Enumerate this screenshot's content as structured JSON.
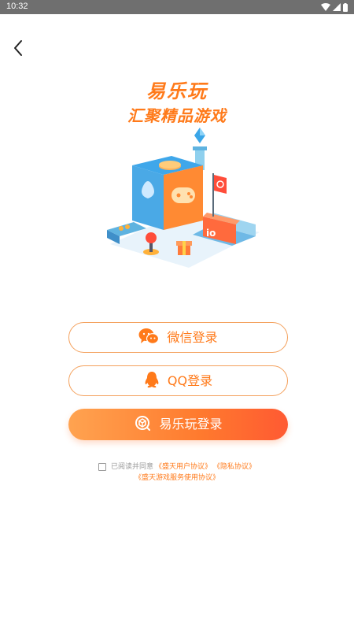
{
  "status_bar": {
    "time": "10:32",
    "icons": [
      "wifi-icon",
      "cellular-signal-icon",
      "battery-icon"
    ]
  },
  "nav": {
    "back_icon": "chevron-left-icon"
  },
  "brand": {
    "title": "易乐玩",
    "slogan": "汇聚精品游戏"
  },
  "login": {
    "wechat_label": "微信登录",
    "qq_label": "QQ登录",
    "yilewan_label": "易乐玩登录"
  },
  "agreement": {
    "prefix": "已阅读并同意",
    "user_agreement": "《盛天用户协议》",
    "privacy_policy": "《隐私协议》",
    "service_agreement": "《盛天游戏服务使用协议》",
    "checked": false
  },
  "colors": {
    "accent": "#ff7a1a",
    "button_border": "#f4a15d",
    "gradient_start": "#ffa350",
    "gradient_end": "#ff5a32",
    "status_bar": "#6f6f6f"
  }
}
